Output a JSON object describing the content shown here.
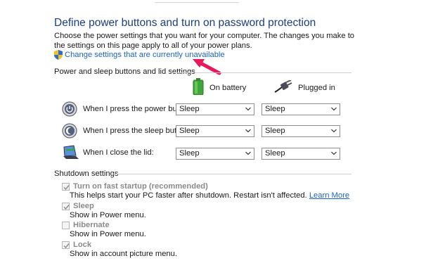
{
  "header": {
    "title": "Define power buttons and turn on password protection",
    "description": "Choose the power settings that you want for your computer. The changes you make to the settings on this page apply to all of your power plans.",
    "change_link": "Change settings that are currently unavailable"
  },
  "power_sleep": {
    "section_title": "Power and sleep buttons and lid settings",
    "columns": {
      "battery": "On battery",
      "plugged": "Plugged in"
    },
    "rows": [
      {
        "label": "When I press the power button:",
        "battery": "Sleep",
        "plugged": "Sleep"
      },
      {
        "label": "When I press the sleep button:",
        "battery": "Sleep",
        "plugged": "Sleep"
      },
      {
        "label": "When I close the lid:",
        "battery": "Sleep",
        "plugged": "Sleep"
      }
    ]
  },
  "shutdown": {
    "section_title": "Shutdown settings",
    "items": [
      {
        "label": "Turn on fast startup (recommended)",
        "checked": true,
        "description": "This helps start your PC faster after shutdown. Restart isn't affected.",
        "link": "Learn More"
      },
      {
        "label": "Sleep",
        "checked": true,
        "description": "Show in Power menu."
      },
      {
        "label": "Hibernate",
        "checked": false,
        "description": "Show in Power menu."
      },
      {
        "label": "Lock",
        "checked": true,
        "description": "Show in account picture menu."
      }
    ]
  },
  "colors": {
    "title": "#1a3d87",
    "link": "#1a64c4",
    "annotation_arrow": "#e8195a",
    "disabled_text": "#8a8a8a"
  },
  "icons": [
    "shield-icon",
    "battery-icon",
    "plug-icon",
    "power-button-icon",
    "sleep-button-icon",
    "laptop-lid-icon",
    "chevron-down-icon",
    "checkmark-icon",
    "annotation-arrow"
  ]
}
